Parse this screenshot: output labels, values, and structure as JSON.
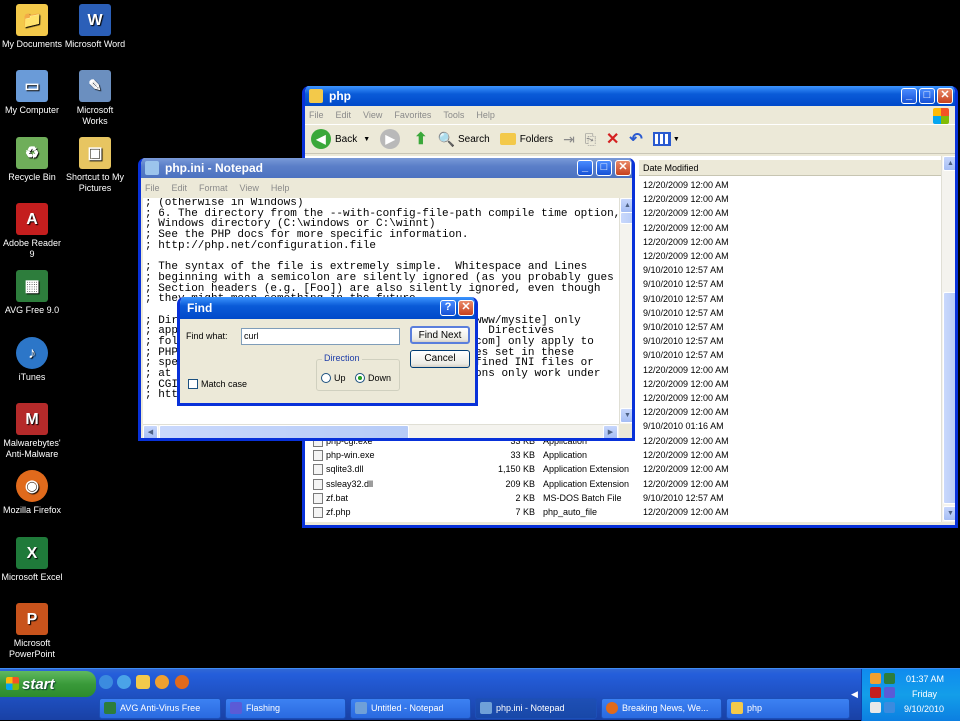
{
  "desktop_icons": [
    {
      "label": "My Documents",
      "color": "#f3c94a",
      "glyph": "📁"
    },
    {
      "label": "Microsoft Word",
      "color": "#2b5fb8",
      "glyph": "W"
    },
    {
      "label": "My Computer",
      "color": "#6a9bd8",
      "glyph": "🖥"
    },
    {
      "label": "Microsoft Works",
      "color": "#6b8fbf",
      "glyph": "✎"
    },
    {
      "label": "Recycle Bin",
      "color": "#6fae5a",
      "glyph": "♻"
    },
    {
      "label": "Shortcut to My Pictures",
      "color": "#e7c561",
      "glyph": "▣"
    },
    {
      "label": "Adobe Reader 9",
      "color": "#c41e1e",
      "glyph": "A"
    },
    {
      "label": "AVG Free 9.0",
      "color": "#2d7d3c",
      "glyph": "▦"
    },
    {
      "label": "iTunes",
      "color": "#2c76c8",
      "glyph": "♪"
    },
    {
      "label": "Malwarebytes' Anti-Malware",
      "color": "#b52a2a",
      "glyph": "M"
    },
    {
      "label": "Mozilla Firefox",
      "color": "#e06a1c",
      "glyph": "◉"
    },
    {
      "label": "Microsoft Excel",
      "color": "#1f7a3a",
      "glyph": "X"
    },
    {
      "label": "Microsoft PowerPoint",
      "color": "#c8531c",
      "glyph": "P"
    }
  ],
  "explorer": {
    "title": "php",
    "menu": [
      "File",
      "Edit",
      "View",
      "Favorites",
      "Tools",
      "Help"
    ],
    "toolbar": {
      "back": "Back",
      "search": "Search",
      "folders": "Folders"
    },
    "column_header": "Date Modified",
    "dates_top": [
      "12/20/2009 12:00 AM",
      "12/20/2009 12:00 AM",
      "12/20/2009 12:00 AM",
      "12/20/2009 12:00 AM",
      "12/20/2009 12:00 AM",
      "12/20/2009 12:00 AM",
      "9/10/2010 12:57 AM",
      "9/10/2010 12:57 AM",
      "9/10/2010 12:57 AM",
      "9/10/2010 12:57 AM",
      "9/10/2010 12:57 AM",
      "9/10/2010 12:57 AM",
      "9/10/2010 12:57 AM",
      "12/20/2009 12:00 AM",
      "12/20/2009 12:00 AM",
      "12/20/2009 12:00 AM",
      "12/20/2009 12:00 AM",
      "9/10/2010 01:16 AM"
    ],
    "files": [
      {
        "name": "php-cgi.exe",
        "size": "33 KB",
        "type": "Application",
        "date": "12/20/2009 12:00 AM"
      },
      {
        "name": "php-win.exe",
        "size": "33 KB",
        "type": "Application",
        "date": "12/20/2009 12:00 AM"
      },
      {
        "name": "sqlite3.dll",
        "size": "1,150 KB",
        "type": "Application Extension",
        "date": "12/20/2009 12:00 AM"
      },
      {
        "name": "ssleay32.dll",
        "size": "209 KB",
        "type": "Application Extension",
        "date": "12/20/2009 12:00 AM"
      },
      {
        "name": "zf.bat",
        "size": "2 KB",
        "type": "MS-DOS Batch File",
        "date": "9/10/2010 12:57 AM"
      },
      {
        "name": "zf.php",
        "size": "7 KB",
        "type": "php_auto_file",
        "date": "12/20/2009 12:00 AM"
      }
    ]
  },
  "notepad": {
    "title": "php.ini - Notepad",
    "menu": [
      "File",
      "Edit",
      "Format",
      "View",
      "Help"
    ],
    "lines": [
      "; (otherwise in Windows)",
      "; 6. The directory from the --with-config-file-path compile time option, o",
      "; Windows directory (C:\\windows or C:\\winnt)",
      "; See the PHP docs for more specific information.",
      "; http://php.net/configuration.file",
      "",
      "; The syntax of the file is extremely simple.  Whitespace and Lines",
      "; beginning with a semicolon are silently ignored (as you probably gues",
      "; Section headers (e.g. [Foo]) are also silently ignored, even though",
      "; they might mean something in the future.",
      "",
      "; Directives following the section heading [PATH=/www/mysite] only",
      "; apply to PHP files in the /www/mysite directory.  Directives",
      "; following the section heading [HOST=www.example.com] only apply to",
      "; PHP files served from www.example.com.  Directives set in these",
      "; special sections cannot be overridden by user-defined INI files or",
      "; at runtime. Currently, [PATH=] and [HOST=] sections only work under",
      "; CGI/FastCGI.",
      "; http://php.net/ini.sections"
    ]
  },
  "find_dialog": {
    "title": "Find",
    "find_what_label": "Find what:",
    "find_what_value": "curl",
    "find_next": "Find Next",
    "cancel": "Cancel",
    "direction_label": "Direction",
    "up": "Up",
    "down": "Down",
    "match_case": "Match case"
  },
  "taskbar": {
    "start": "start",
    "tasks": [
      {
        "label": "AVG Anti-Virus Free",
        "color": "#2d7d3c",
        "active": false
      },
      {
        "label": "Flashing",
        "color": "#5b5bd6",
        "active": false
      },
      {
        "label": "Untitled - Notepad",
        "color": "#6fa0d8",
        "active": false
      },
      {
        "label": "php.ini - Notepad",
        "color": "#6fa0d8",
        "active": true
      },
      {
        "label": "Breaking News, We...",
        "color": "#e06a1c",
        "active": false
      },
      {
        "label": "php",
        "color": "#f3c94a",
        "active": false
      }
    ],
    "clock_time": "01:37 AM",
    "clock_day": "Friday",
    "clock_date": "9/10/2010"
  }
}
